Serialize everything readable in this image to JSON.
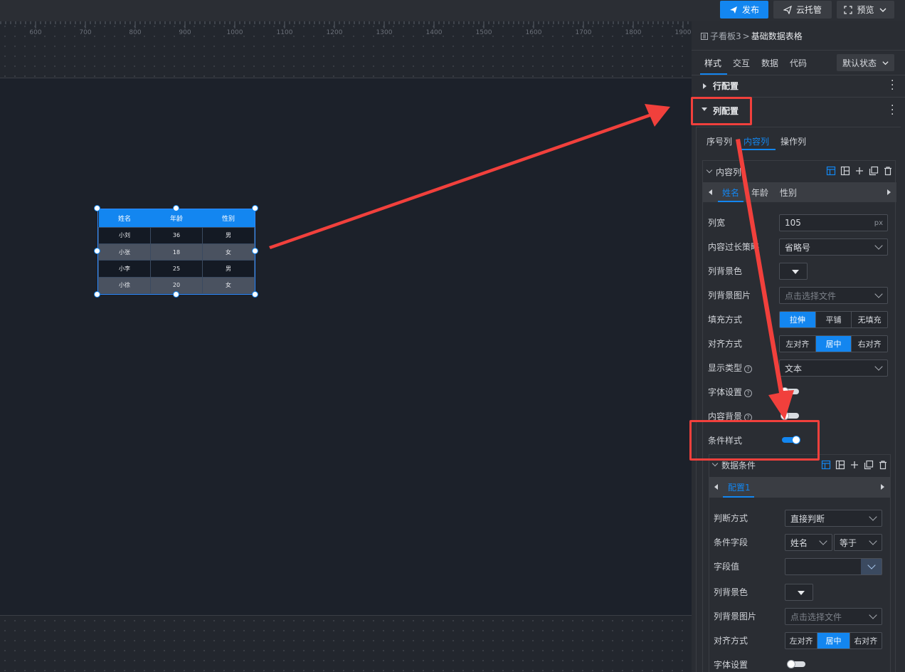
{
  "topbar": {
    "publish": "发布",
    "cloud": "云托管",
    "preview": "预览"
  },
  "ruler": {
    "labels": [
      "600",
      "700",
      "800",
      "900",
      "1000",
      "1100",
      "1200",
      "1300",
      "1400",
      "1500",
      "1600",
      "1700",
      "1800",
      "1900"
    ]
  },
  "table_widget": {
    "headers": [
      "姓名",
      "年龄",
      "性别"
    ],
    "rows": [
      [
        "小刘",
        "36",
        "男"
      ],
      [
        "小张",
        "18",
        "女"
      ],
      [
        "小李",
        "25",
        "男"
      ],
      [
        "小徐",
        "20",
        "女"
      ]
    ]
  },
  "panel": {
    "breadcrumb": {
      "parent": "子看板3",
      "separator": ">",
      "current": "基础数据表格"
    },
    "main_tabs": [
      "样式",
      "交互",
      "数据",
      "代码"
    ],
    "state_select": "默认状态",
    "row_config": "行配置",
    "col_config": "列配置",
    "col_tabs": [
      "序号列",
      "内容列",
      "操作列"
    ],
    "content_col": {
      "title": "内容列",
      "field_tabs": [
        "姓名",
        "年龄",
        "性别"
      ],
      "width_label": "列宽",
      "width_value": "105",
      "width_unit": "px",
      "overflow_label": "内容过长策略",
      "overflow_value": "省略号",
      "bg_color_label": "列背景色",
      "bg_image_label": "列背景图片",
      "bg_image_placeholder": "点击选择文件",
      "fill_label": "填充方式",
      "fill_options": [
        "拉伸",
        "平铺",
        "无填充"
      ],
      "align_label": "对齐方式",
      "align_options": [
        "左对齐",
        "居中",
        "右对齐"
      ],
      "display_label": "显示类型",
      "display_value": "文本",
      "font_label": "字体设置",
      "content_bg_label": "内容背景",
      "cond_style_label": "条件样式",
      "help_glyph": "?"
    },
    "data_cond": {
      "title": "数据条件",
      "config_tab": "配置1",
      "judge_label": "判断方式",
      "judge_value": "直接判断",
      "field_label": "条件字段",
      "field_value": "姓名",
      "op_value": "等于",
      "value_label": "字段值",
      "bg_color_label": "列背景色",
      "bg_image_label": "列背景图片",
      "bg_image_placeholder": "点击选择文件",
      "align_label": "对齐方式",
      "align_options": [
        "左对齐",
        "居中",
        "右对齐"
      ],
      "font_label": "字体设置"
    }
  },
  "colors": {
    "accent": "#1386f0",
    "annotation": "#f1403c"
  }
}
